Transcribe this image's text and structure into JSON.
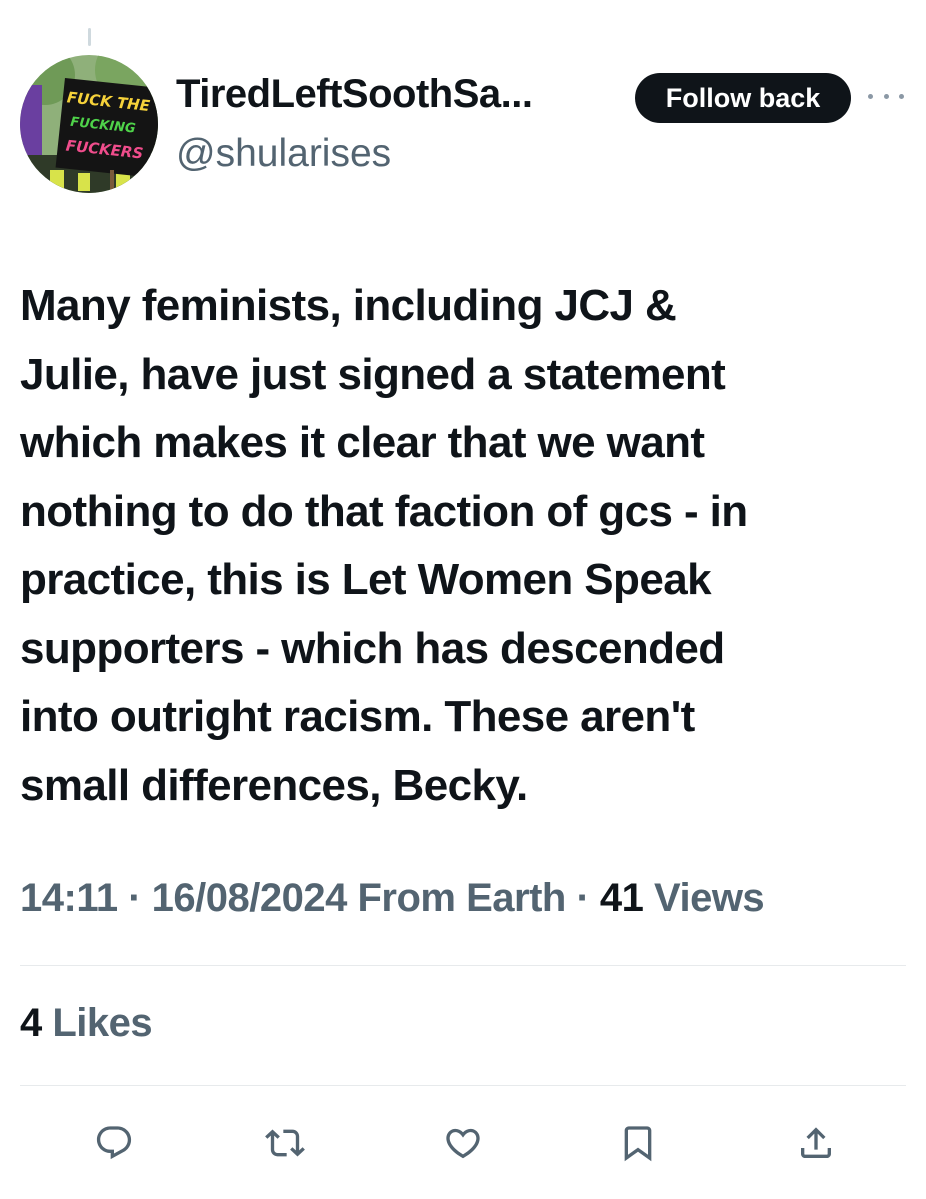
{
  "author": {
    "display_name": "TiredLeftSoothSa...",
    "handle": "@shularises",
    "avatar_sign_text": [
      "FUCK THE",
      "FUCKING",
      "FUCKERS"
    ]
  },
  "follow_button": {
    "label": "Follow back"
  },
  "more_button": {
    "icon": "more-horizontal-icon"
  },
  "tweet": {
    "lines": [
      "Many feminists, including JCJ &",
      "Julie, have just signed a statement",
      "which makes it clear that we want",
      "nothing to do that faction of gcs - in",
      "practice, this is Let Women Speak",
      "supporters - which has descended",
      "into outright racism. These aren't",
      "small differences, Becky."
    ]
  },
  "meta": {
    "time": "14:11",
    "separator": " · ",
    "date": "16/08/2024",
    "source": " From Earth",
    "views_count": "41",
    "views_label": " Views"
  },
  "stats": {
    "likes_count": "4",
    "likes_label": " Likes"
  },
  "actions": [
    {
      "icon": "reply-icon"
    },
    {
      "icon": "retweet-icon"
    },
    {
      "icon": "like-icon"
    },
    {
      "icon": "bookmark-icon"
    },
    {
      "icon": "share-icon"
    }
  ],
  "colors": {
    "text_primary": "#0f1419",
    "text_secondary": "#536471",
    "divider": "#e7eaec",
    "button_bg": "#0f1419",
    "icon": "#536471"
  }
}
